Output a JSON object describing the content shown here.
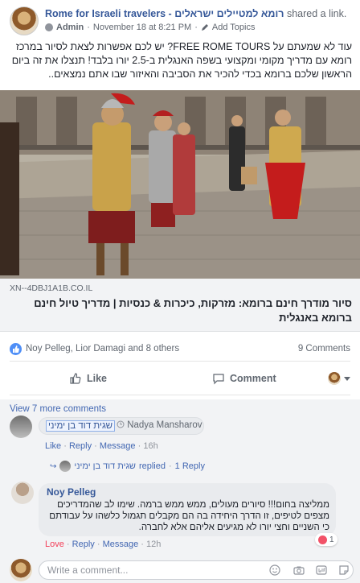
{
  "header": {
    "page_name": "Rome for Israeli travelers - רומא למטיילים ישראלים",
    "action": "shared a link.",
    "author": "Admin",
    "timestamp": "November 18 at 8:21 PM",
    "add_topics": "Add Topics"
  },
  "post": {
    "text": "עוד לא שמעתם על FREE ROME TOURS? יש לכם אפשרות לצאת לסיור במרכז רומא עם מדריך מקומי ומקצועי בשפה האנגלית ב-2.5 יורו בלבד! תנצלו את זה ביום הראשון שלכם ברומא בכדי להכיר את הסביבה והאיזור שבו אתם נמצאים.."
  },
  "link": {
    "domain": "XN--4DBJ1A1B.CO.IL",
    "title": "סיור מודרך חינם ברומא: מזרקות, כיכרות & כנסיות | מדריך טיול חינם ברומא באנגלית"
  },
  "reactions": {
    "names": "Noy Pelleg, Lior Damagi and 8 others",
    "comments_count": "9 Comments"
  },
  "actions": {
    "like": "Like",
    "comment": "Comment"
  },
  "comments": {
    "view_more": "View 7 more comments",
    "c1": {
      "tag": "שגית דוד בן ימיני",
      "author": "Nadya Mansharov",
      "like": "Like",
      "reply": "Reply",
      "message": "Message",
      "time": "16h",
      "replied_name": "שגית דוד בן ימיני",
      "replied_text": "replied",
      "replies": "1 Reply"
    },
    "c2": {
      "author": "Noy Pelleg",
      "text": "ממליצה בחום!!! סיורים מעולים, ממש ממש ברמה. שימו לב שהמדריכים מצפים לטיפים, זו הדרך היחידה בה הם מקבלים תגמול כלשהו על עבודתם כי השניים וחצי יורו לא מגיעים אליהם אלא לחברה.",
      "reaction_count": "1",
      "love": "Love",
      "reply": "Reply",
      "message": "Message",
      "time": "12h"
    },
    "write_placeholder": "Write a comment..."
  },
  "colors": {
    "link_blue": "#365899",
    "action_blue": "#4267b2",
    "love_red": "#f33e58",
    "like_badge": "#4f8ff7"
  }
}
